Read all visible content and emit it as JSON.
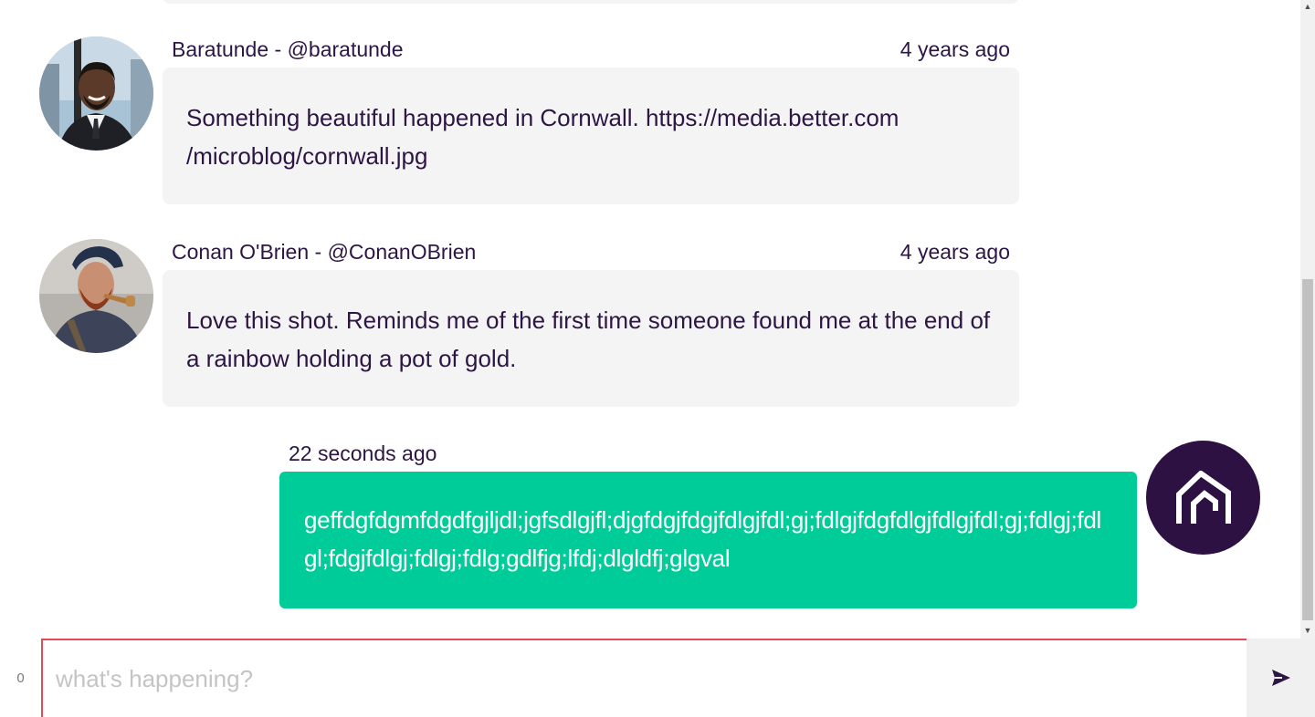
{
  "feed": {
    "posts": [
      {
        "author": "Baratunde - @baratunde",
        "time": "4 years ago",
        "text": "Something beautiful happened in Cornwall. https://media.better.com /microblog/cornwall.jpg"
      },
      {
        "author": "Conan O'Brien - @ConanOBrien",
        "time": "4 years ago",
        "text": "Love this shot. Reminds me of the first time someone found me at the end of a rainbow holding a pot of gold."
      }
    ],
    "my_post": {
      "time": "22 seconds ago",
      "text": "geffdgfdgmfdgdfgjljdl;jgfsdlgjfl;djgfdgjfdgjfdlgjfdl;gj;fdlgjfdgfdlgjfdlgjfdl;gj;fdlgj;fdlgl;fdgjfdlgj;fdlgj;fdlg;gdlfjg;lfdj;dlgldfj;glgval"
    }
  },
  "composer": {
    "counter": "0",
    "placeholder": "what's happening?",
    "send_icon": "send-icon"
  },
  "colors": {
    "text": "#2d1544",
    "bubble_bg": "#f4f4f4",
    "mine_bg": "#00cc99",
    "logo_bg": "#2d1143",
    "input_border": "#e24b56"
  }
}
